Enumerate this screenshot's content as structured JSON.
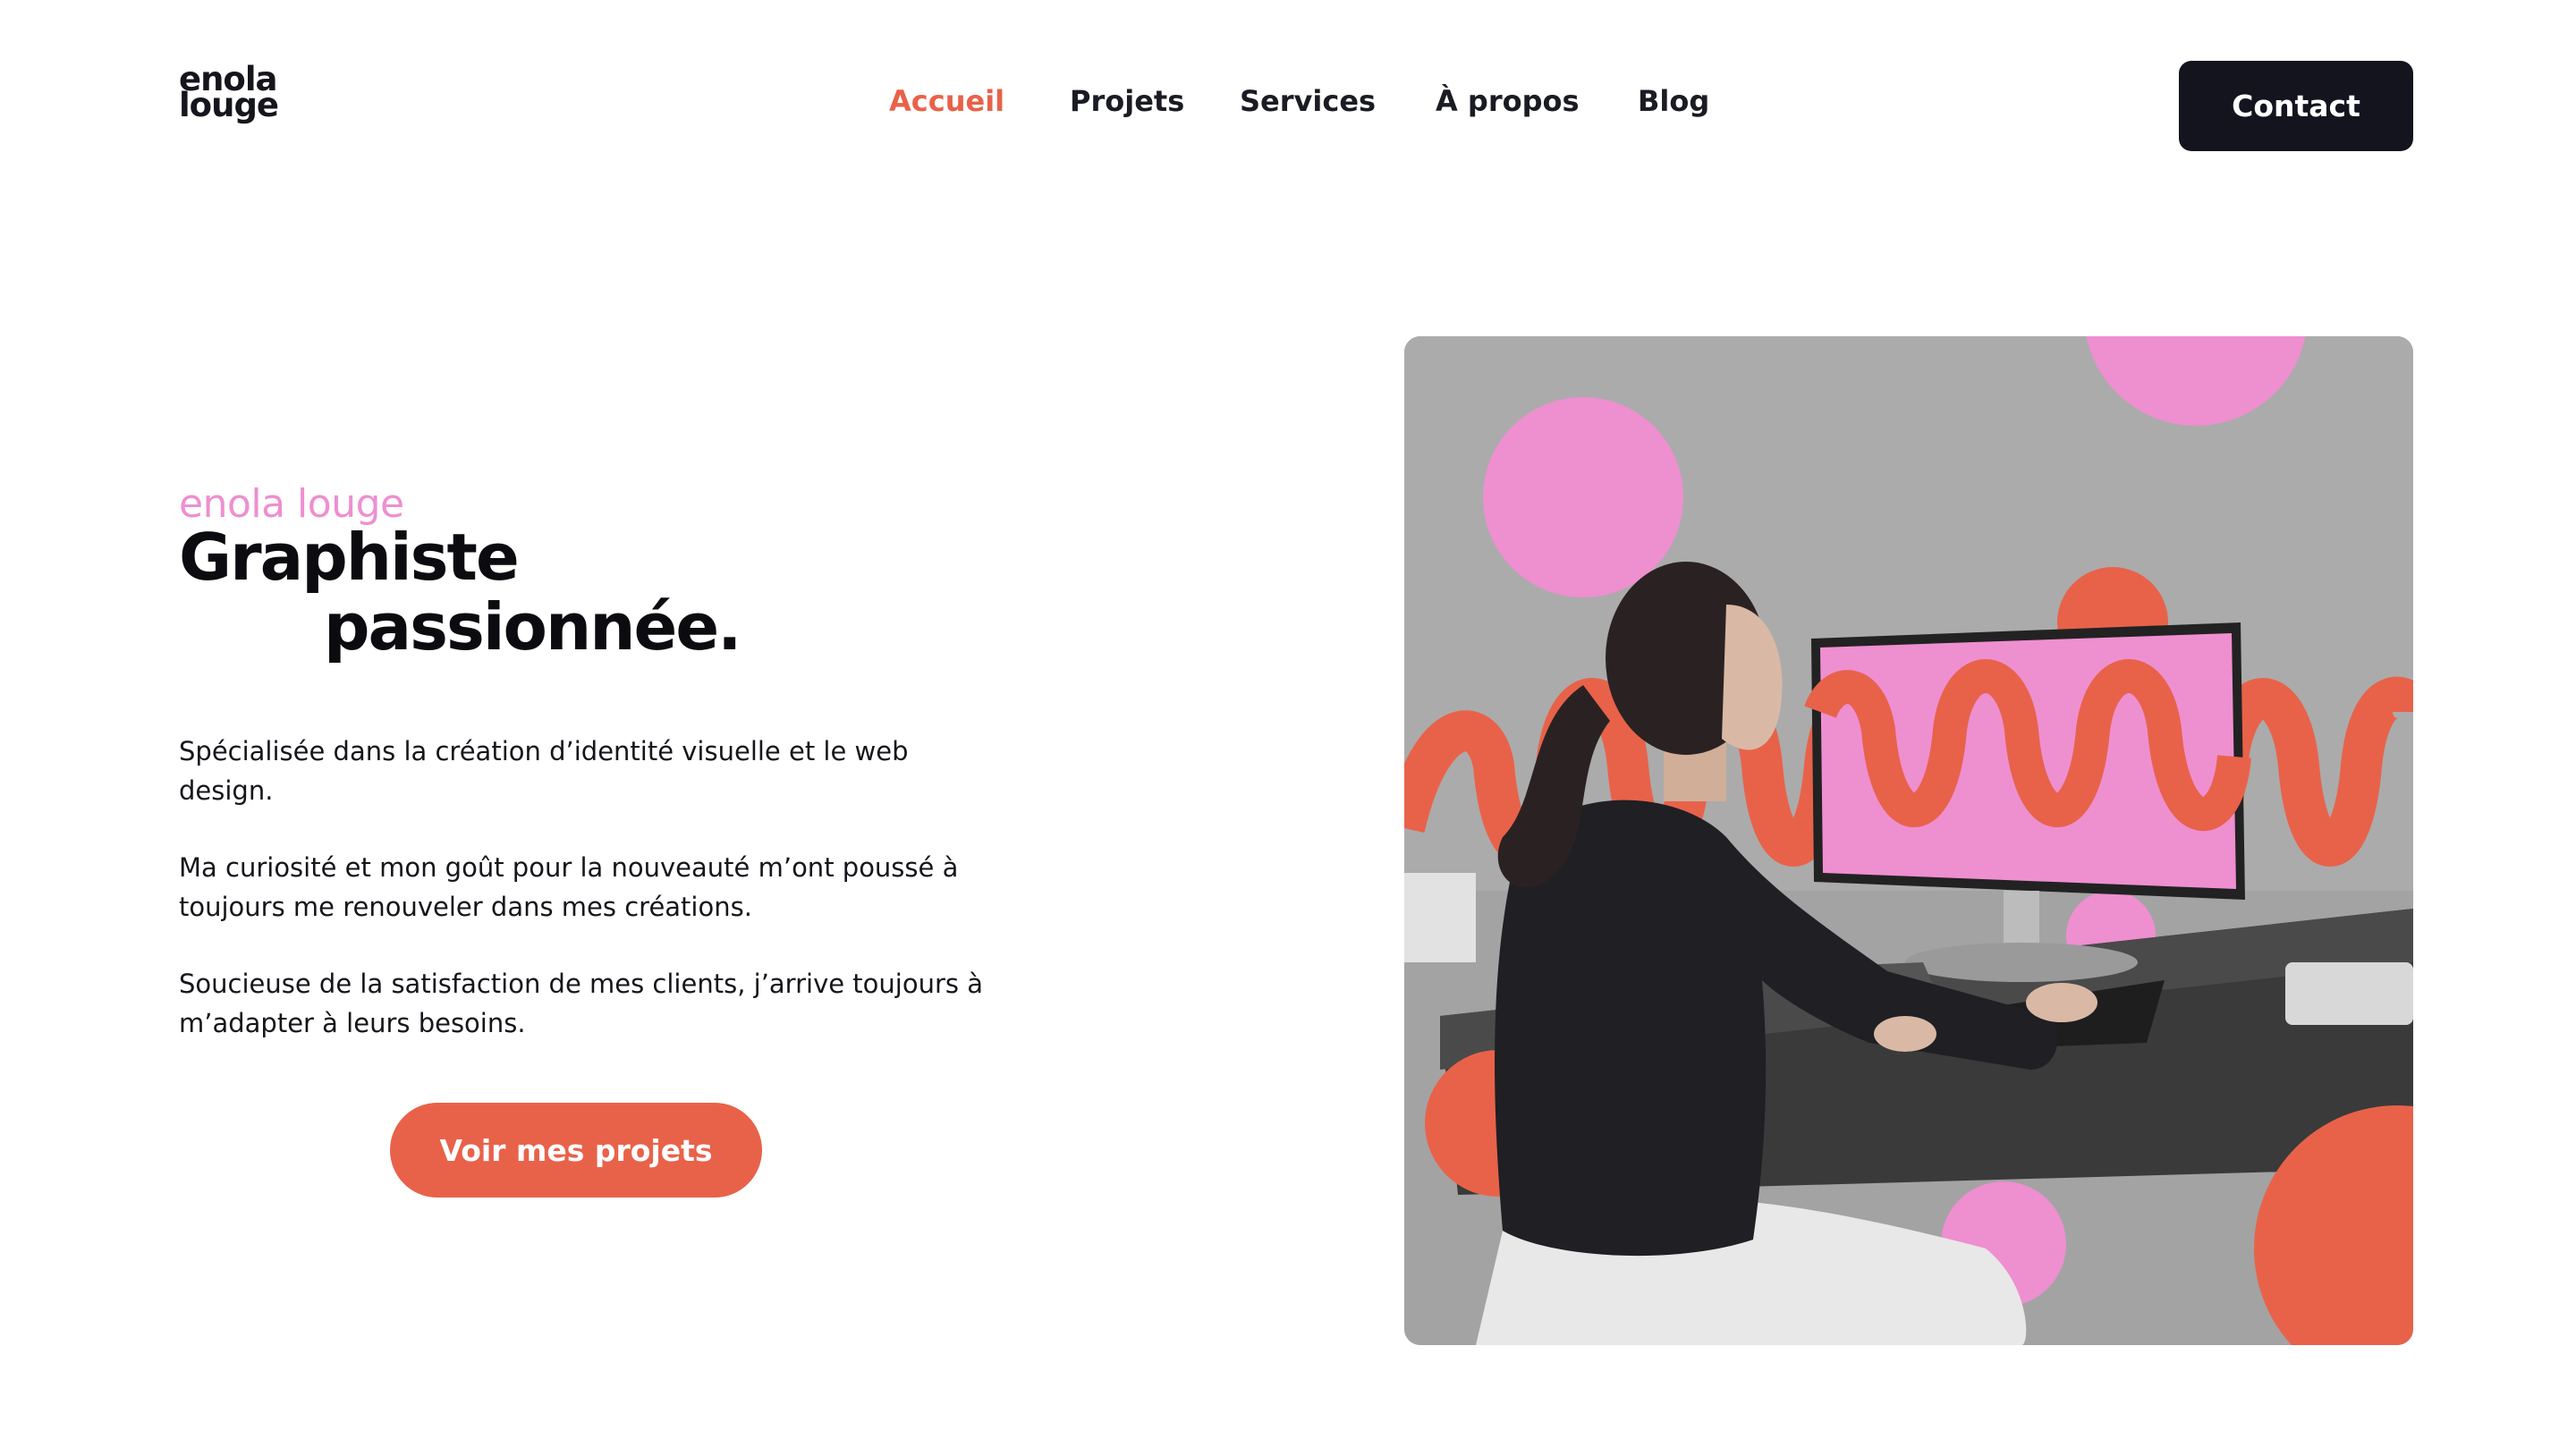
{
  "brand": {
    "logo_line1": "enola",
    "logo_line2": "louge"
  },
  "nav": {
    "items": [
      {
        "label": "Accueil",
        "active": true
      },
      {
        "label": "Projets",
        "active": false
      },
      {
        "label": "Services",
        "active": false
      },
      {
        "label": "À propos",
        "active": false
      },
      {
        "label": "Blog",
        "active": false
      }
    ]
  },
  "header": {
    "contact_label": "Contact"
  },
  "hero": {
    "eyebrow": "enola louge",
    "title_line1": "Graphiste",
    "title_line2": "passionnée.",
    "paragraphs": [
      "Spécialisée dans la création d’identité visuelle et le web design.",
      "Ma curiosité et mon goût pour la nouveauté m’ont poussé à toujours me renouveler dans mes créations.",
      "Soucieuse de la satisfaction de mes clients, j’arrive toujours à m’adapter à leurs besoins."
    ],
    "cta_label": "Voir mes projets"
  },
  "colors": {
    "accent": "#e8624a",
    "pink": "#ee8fd0",
    "dark": "#14141f"
  }
}
